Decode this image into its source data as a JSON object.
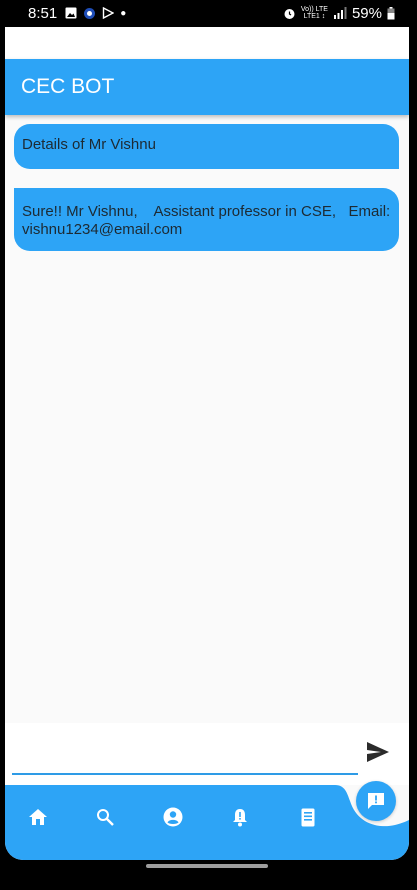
{
  "status_bar": {
    "time": "8:51",
    "battery": "59%",
    "net_top": "Vo)) LTE",
    "net_bottom": "LTE1 ↕"
  },
  "app_bar": {
    "title": "CEC BOT"
  },
  "messages": [
    {
      "sender": "user",
      "text": "Details of Mr Vishnu"
    },
    {
      "sender": "bot",
      "text": "Sure!! Mr Vishnu,    Assistant professor in CSE,   Email: vishnu1234@email.com"
    }
  ],
  "composer": {
    "value": "",
    "placeholder": ""
  },
  "bottom_nav": {
    "items": [
      "home-icon",
      "search-icon",
      "account-circle-icon",
      "notification-alert-icon",
      "document-icon"
    ],
    "fab_icon": "feedback-icon"
  },
  "colors": {
    "primary": "#2da4f6",
    "background": "#fafafa",
    "text_dark": "#1d2a33"
  }
}
